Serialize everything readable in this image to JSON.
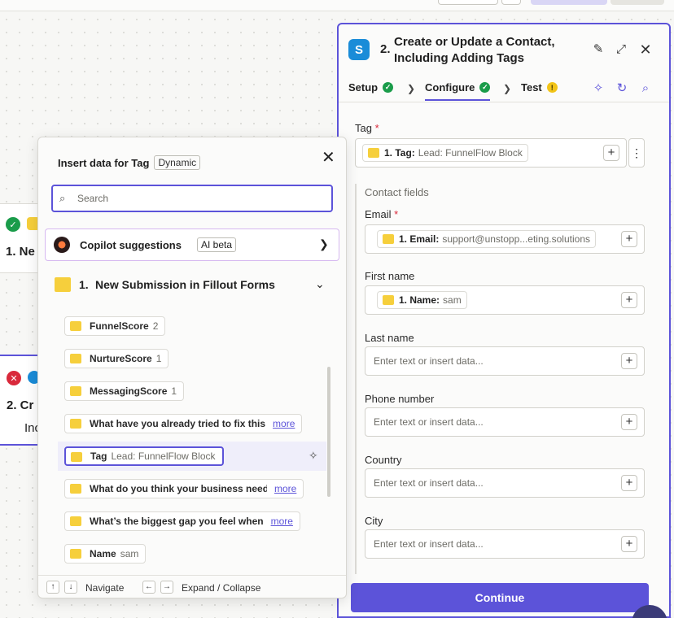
{
  "canvas": {
    "node1": {
      "title": "1. Ne"
    },
    "node2": {
      "title": "2. Cr",
      "subtitle": "Inc"
    }
  },
  "panel": {
    "step_num": "2.",
    "title": "Create or Update a Contact, Including Adding Tags",
    "tabs": [
      {
        "label": "Setup",
        "status": "ok"
      },
      {
        "label": "Configure",
        "status": "ok"
      },
      {
        "label": "Test",
        "status": "warning"
      }
    ],
    "tag_field": {
      "label": "Tag",
      "required": "*",
      "pill_label": "1. Tag:",
      "pill_value": "Lead: FunnelFlow Block"
    },
    "section_label": "Contact fields",
    "email_field": {
      "label": "Email",
      "required": "*",
      "pill_label": "1. Email:",
      "pill_value": "support@unstopp...eting.solutions"
    },
    "first_name_field": {
      "label": "First name",
      "pill_label": "1. Name:",
      "pill_value": "sam"
    },
    "last_name_field": {
      "label": "Last name",
      "placeholder": "Enter text or insert data..."
    },
    "phone_field": {
      "label": "Phone number",
      "placeholder": "Enter text or insert data..."
    },
    "country_field": {
      "label": "Country",
      "placeholder": "Enter text or insert data..."
    },
    "city_field": {
      "label": "City",
      "placeholder": "Enter text or insert data..."
    },
    "continue_label": "Continue"
  },
  "popover": {
    "title": "Insert data for Tag",
    "badge": "Dynamic",
    "search_placeholder": "Search",
    "copilot": {
      "label": "Copilot suggestions",
      "badge": "AI beta"
    },
    "group": {
      "number": "1.",
      "label": "New Submission in Fillout Forms"
    },
    "items": [
      {
        "label": "FunnelScore",
        "value": "2"
      },
      {
        "label": "NurtureScore",
        "value": "1"
      },
      {
        "label": "MessagingScore",
        "value": "1"
      },
      {
        "label": "What have you already tried to fix this",
        "more": "more"
      },
      {
        "label": "Tag",
        "value": "Lead: FunnelFlow Block"
      },
      {
        "label": "What do you think your business need",
        "more": "more"
      },
      {
        "label": "What’s the biggest gap you feel when",
        "more": "more"
      },
      {
        "label": "Name",
        "value": "sam"
      }
    ],
    "footer": {
      "navigate": "Navigate",
      "expand": "Expand / Collapse"
    }
  },
  "icons": {
    "edit": "pencil-icon",
    "expand": "expand-icon",
    "close": "close-icon",
    "copilot": "sparkle-icon",
    "undo": "rotate-icon",
    "search": "search-icon"
  },
  "colors": {
    "accent": "#5c53d9",
    "ok": "#1a9c4a",
    "warn": "#f2c417",
    "error": "#d9293b",
    "fillout": "#f6cf3c"
  }
}
